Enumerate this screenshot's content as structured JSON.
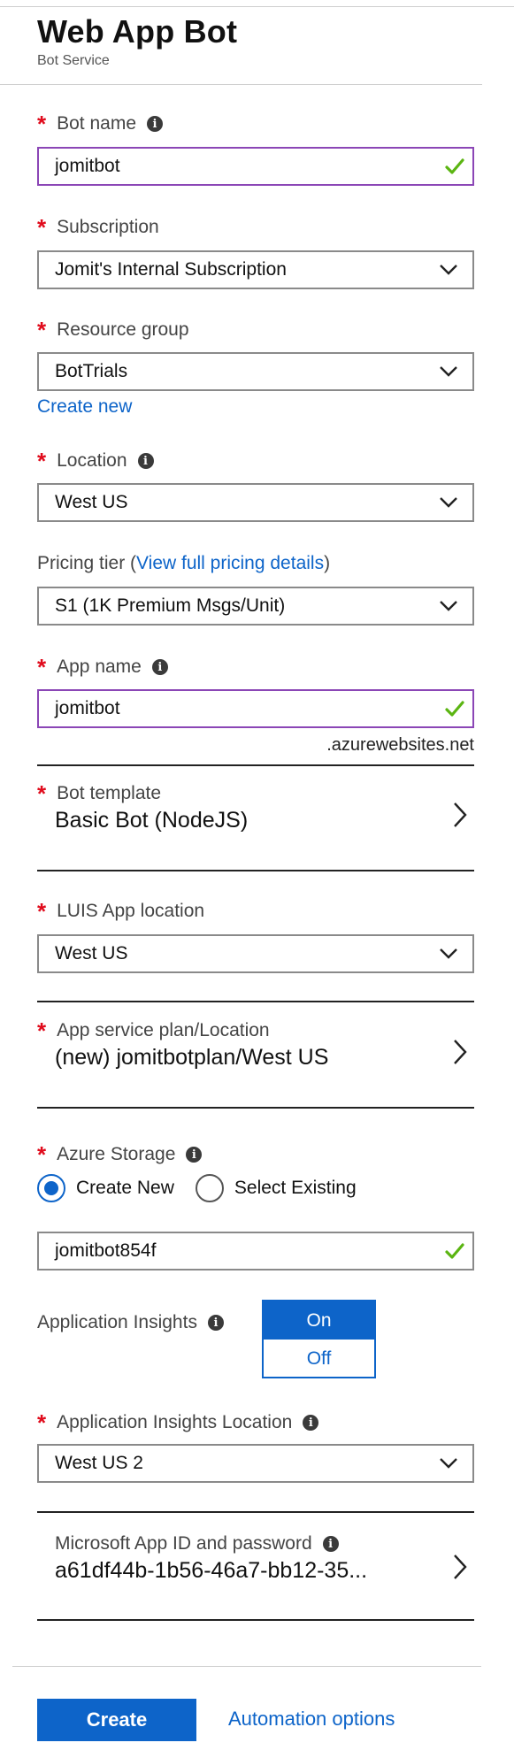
{
  "header": {
    "title": "Web App Bot",
    "subtitle": "Bot Service"
  },
  "bot_name": {
    "label": "Bot name",
    "value": "jomitbot"
  },
  "subscription": {
    "label": "Subscription",
    "value": "Jomit's Internal Subscription"
  },
  "resource_group": {
    "label": "Resource group",
    "value": "BotTrials",
    "create_new": "Create new"
  },
  "location": {
    "label": "Location",
    "value": "West US"
  },
  "pricing": {
    "label_prefix": "Pricing tier (",
    "link": "View full pricing details",
    "label_suffix": ")",
    "value": "S1 (1K Premium Msgs/Unit)"
  },
  "app_name": {
    "label": "App name",
    "value": "jomitbot",
    "suffix": ".azurewebsites.net"
  },
  "bot_template": {
    "label": "Bot template",
    "value": "Basic Bot (NodeJS)"
  },
  "luis": {
    "label": "LUIS App location",
    "value": "West US"
  },
  "plan": {
    "label": "App service plan/Location",
    "value": "(new) jomitbotplan/West US"
  },
  "storage": {
    "label": "Azure Storage",
    "option_new": "Create New",
    "option_existing": "Select Existing",
    "value": "jomitbot854f"
  },
  "insights": {
    "label": "Application Insights",
    "on": "On",
    "off": "Off"
  },
  "insights_location": {
    "label": "Application Insights Location",
    "value": "West US 2"
  },
  "app_id": {
    "label": "Microsoft App ID and password",
    "value": "a61df44b-1b56-46a7-bb12-35..."
  },
  "footer": {
    "create": "Create",
    "automation": "Automation options"
  },
  "colors": {
    "accent": "#0d64c9",
    "required": "#e00b1c",
    "valid_check": "#5bb512",
    "active_border": "#8b46b6"
  }
}
